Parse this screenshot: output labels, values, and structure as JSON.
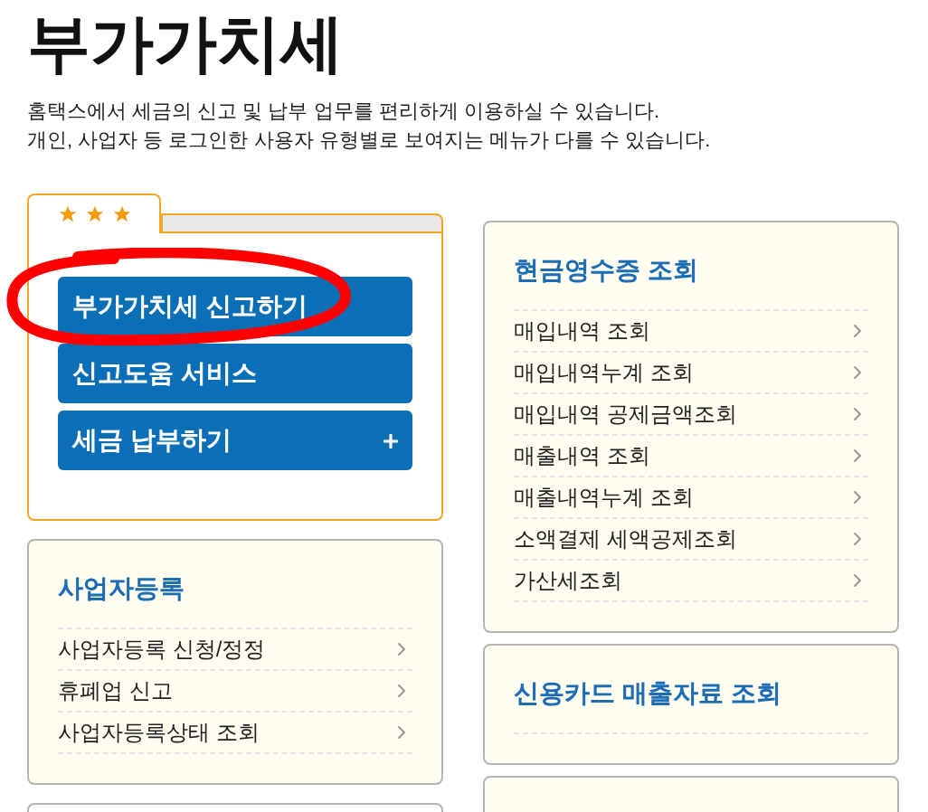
{
  "title": "부가가치세",
  "description": [
    "홈택스에서 세금의 신고 및 납부 업무를 편리하게 이용하실 수 있습니다.",
    "개인, 사업자 등 로그인한 사용자 유형별로 보여지는 메뉴가 다를 수 있습니다."
  ],
  "favorites": {
    "stars": 3,
    "buttons": [
      {
        "label": "부가가치세 신고하기",
        "kind": "link"
      },
      {
        "label": "신고도움 서비스",
        "kind": "link"
      },
      {
        "label": "세금 납부하기",
        "kind": "menu"
      }
    ]
  },
  "left_cards": [
    {
      "title": "사업자등록",
      "items": [
        "사업자등록 신청/정정",
        "휴폐업 신고",
        "사업자등록상태 조회"
      ]
    }
  ],
  "right_cards": [
    {
      "title": "현금영수증 조회",
      "items": [
        "매입내역 조회",
        "매입내역누계 조회",
        "매입내역 공제금액조회",
        "매출내역 조회",
        "매출내역누계 조회",
        "소액결제 세액공제조회",
        "가산세조회"
      ]
    },
    {
      "title": "신용카드 매출자료 조회"
    }
  ]
}
